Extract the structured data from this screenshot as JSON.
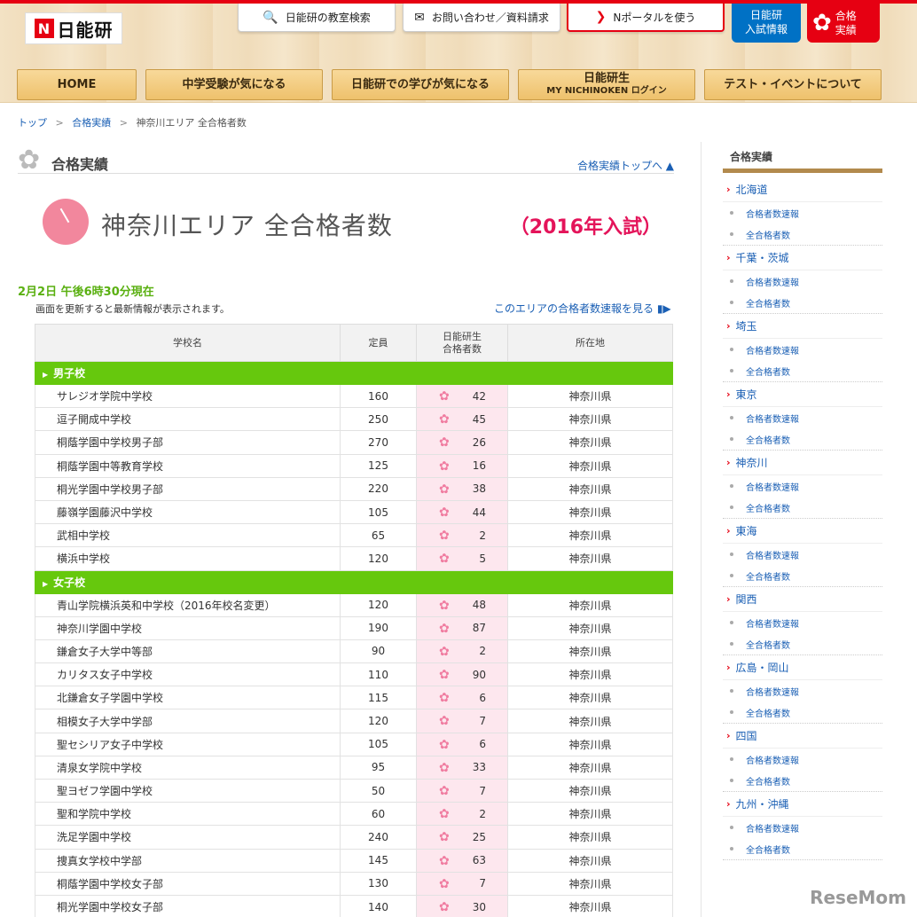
{
  "header": {
    "logo_text": "日能研",
    "logo_mark": "N",
    "top_buttons": {
      "search": "日能研の教室検索",
      "contact": "お問い合わせ／資料請求",
      "portal": "Nポータルを使う",
      "nyushi": [
        "日能研",
        "入試情報"
      ],
      "gokaku": [
        "合格",
        "実績"
      ]
    },
    "nav": [
      {
        "label": "HOME"
      },
      {
        "label": "中学受験が気になる"
      },
      {
        "label": "日能研での学びが気になる"
      },
      {
        "label": "日能研生",
        "sub": "MY NICHINOKEN ログイン"
      },
      {
        "label": "テスト・イベントについて"
      }
    ]
  },
  "breadcrumb": {
    "items": [
      "トップ",
      "合格実績",
      "神奈川エリア 全合格者数"
    ],
    "separator": ">"
  },
  "section": {
    "title": "合格実績",
    "top_link": "合格実績トップへ ▲"
  },
  "page": {
    "title": "神奈川エリア 全合格者数",
    "year": "（2016年入試）",
    "update_time": "2月2日 午後6時30分現在",
    "update_note": "画面を更新すると最新情報が表示されます。",
    "sokuho_link": "このエリアの合格者数速報を見る ▮▶"
  },
  "table": {
    "headers": {
      "school": "学校名",
      "capacity": "定員",
      "passed_line1": "日能研生",
      "passed_line2": "合格者数",
      "location": "所在地"
    },
    "groups": [
      {
        "category": "男子校",
        "rows": [
          {
            "school": "サレジオ学院中学校",
            "capacity": "160",
            "passed": "42",
            "location": "神奈川県"
          },
          {
            "school": "逗子開成中学校",
            "capacity": "250",
            "passed": "45",
            "location": "神奈川県"
          },
          {
            "school": "桐蔭学園中学校男子部",
            "capacity": "270",
            "passed": "26",
            "location": "神奈川県"
          },
          {
            "school": "桐蔭学園中等教育学校",
            "capacity": "125",
            "passed": "16",
            "location": "神奈川県"
          },
          {
            "school": "桐光学園中学校男子部",
            "capacity": "220",
            "passed": "38",
            "location": "神奈川県"
          },
          {
            "school": "藤嶺学園藤沢中学校",
            "capacity": "105",
            "passed": "44",
            "location": "神奈川県"
          },
          {
            "school": "武相中学校",
            "capacity": "65",
            "passed": "2",
            "location": "神奈川県"
          },
          {
            "school": "横浜中学校",
            "capacity": "120",
            "passed": "5",
            "location": "神奈川県"
          }
        ]
      },
      {
        "category": "女子校",
        "rows": [
          {
            "school": "青山学院横浜英和中学校（2016年校名変更）",
            "capacity": "120",
            "passed": "48",
            "location": "神奈川県"
          },
          {
            "school": "神奈川学園中学校",
            "capacity": "190",
            "passed": "87",
            "location": "神奈川県"
          },
          {
            "school": "鎌倉女子大学中等部",
            "capacity": "90",
            "passed": "2",
            "location": "神奈川県"
          },
          {
            "school": "カリタス女子中学校",
            "capacity": "110",
            "passed": "90",
            "location": "神奈川県"
          },
          {
            "school": "北鎌倉女子学園中学校",
            "capacity": "115",
            "passed": "6",
            "location": "神奈川県"
          },
          {
            "school": "相模女子大学中学部",
            "capacity": "120",
            "passed": "7",
            "location": "神奈川県"
          },
          {
            "school": "聖セシリア女子中学校",
            "capacity": "105",
            "passed": "6",
            "location": "神奈川県"
          },
          {
            "school": "清泉女学院中学校",
            "capacity": "95",
            "passed": "33",
            "location": "神奈川県"
          },
          {
            "school": "聖ヨゼフ学園中学校",
            "capacity": "50",
            "passed": "7",
            "location": "神奈川県"
          },
          {
            "school": "聖和学院中学校",
            "capacity": "60",
            "passed": "2",
            "location": "神奈川県"
          },
          {
            "school": "洗足学園中学校",
            "capacity": "240",
            "passed": "25",
            "location": "神奈川県"
          },
          {
            "school": "捜真女学校中学部",
            "capacity": "145",
            "passed": "63",
            "location": "神奈川県"
          },
          {
            "school": "桐蔭学園中学校女子部",
            "capacity": "130",
            "passed": "7",
            "location": "神奈川県"
          },
          {
            "school": "桐光学園中学校女子部",
            "capacity": "140",
            "passed": "30",
            "location": "神奈川県"
          }
        ]
      }
    ]
  },
  "sidebar": {
    "title": "合格実績",
    "regions": [
      {
        "name": "北海道",
        "links": [
          "合格者数速報",
          "全合格者数"
        ]
      },
      {
        "name": "千葉・茨城",
        "links": [
          "合格者数速報",
          "全合格者数"
        ]
      },
      {
        "name": "埼玉",
        "links": [
          "合格者数速報",
          "全合格者数"
        ]
      },
      {
        "name": "東京",
        "links": [
          "合格者数速報",
          "全合格者数"
        ]
      },
      {
        "name": "神奈川",
        "links": [
          "合格者数速報",
          "全合格者数"
        ]
      },
      {
        "name": "東海",
        "links": [
          "合格者数速報",
          "全合格者数"
        ]
      },
      {
        "name": "関西",
        "links": [
          "合格者数速報",
          "全合格者数"
        ]
      },
      {
        "name": "広島・岡山",
        "links": [
          "合格者数速報",
          "全合格者数"
        ]
      },
      {
        "name": "四国",
        "links": [
          "合格者数速報",
          "全合格者数"
        ]
      },
      {
        "name": "九州・沖縄",
        "links": [
          "合格者数速報",
          "全合格者数"
        ]
      }
    ]
  },
  "watermark": "ReseMom",
  "colors": {
    "brand_red": "#e60012",
    "category_green": "#66c80d",
    "link_blue": "#1a5fb4",
    "year_pink": "#e4145a",
    "passed_bg": "#fde7ee"
  },
  "icons": {
    "search": "magnifier-icon",
    "contact": "envelope-icon",
    "portal": "chevron-right-icon",
    "gokaku": "sakura-icon",
    "section": "sakura-icon"
  }
}
